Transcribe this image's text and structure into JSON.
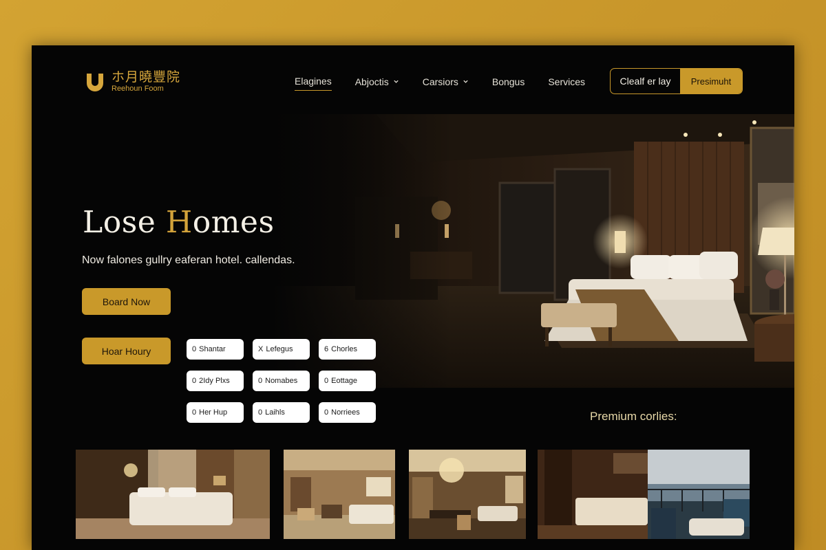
{
  "brand": {
    "name": "ホ月曉豐院",
    "subtitle": "Reehoun Foom",
    "accent_color": "#c9992a"
  },
  "nav": {
    "items": [
      {
        "label": "Elagines",
        "active": true,
        "dropdown": false
      },
      {
        "label": "Abjoctis",
        "active": false,
        "dropdown": true
      },
      {
        "label": "Carsiors",
        "active": false,
        "dropdown": true
      },
      {
        "label": "Bongus",
        "active": false,
        "dropdown": false
      },
      {
        "label": "Services",
        "active": false,
        "dropdown": false
      }
    ],
    "cta_outline": "Clealf er lay",
    "cta_filled": "Presimuht"
  },
  "hero": {
    "title_pre": "Lose ",
    "title_accent": "H",
    "title_post": "omes",
    "subtitle": "Now falones gullry eaferan hotel. callendas.",
    "book_button": "Board Now",
    "hour_button": "Hoar Houry"
  },
  "chips": [
    {
      "prefix": "0",
      "label": "Shantar"
    },
    {
      "prefix": "X",
      "label": "Lefegus"
    },
    {
      "prefix": "6",
      "label": "Chorles"
    },
    {
      "prefix": "0",
      "label": "2Idy Plxs"
    },
    {
      "prefix": "0",
      "label": "Nomabes"
    },
    {
      "prefix": "0",
      "label": "Eottage"
    },
    {
      "prefix": "0",
      "label": "Her Hup"
    },
    {
      "prefix": "0",
      "label": "Laihls"
    },
    {
      "prefix": "0",
      "label": "Norriees"
    }
  ],
  "premium": {
    "label": "Premium corlies:"
  },
  "gallery": {
    "icons": [
      "bedroom-photo",
      "suite-photo",
      "dining-photo",
      "ocean-view-photo"
    ]
  }
}
